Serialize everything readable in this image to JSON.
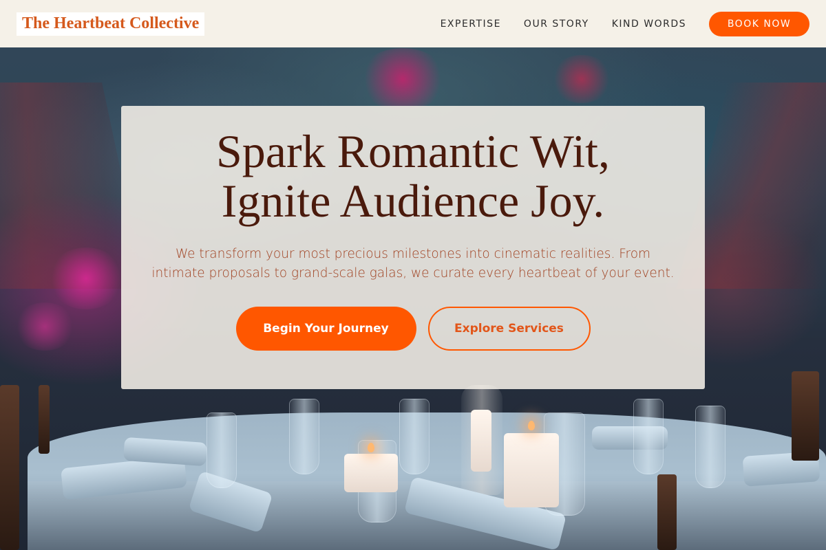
{
  "brand": {
    "name": "The Heartbeat Collective",
    "accent_color": "#ff5700",
    "logo_text_color": "#d5591c",
    "heading_color": "#4a1a0c"
  },
  "nav": {
    "links": [
      {
        "label": "EXPERTISE"
      },
      {
        "label": "OUR STORY"
      },
      {
        "label": "KIND WORDS"
      }
    ],
    "cta_label": "BOOK NOW"
  },
  "hero": {
    "title_line1": "Spark Romantic Wit,",
    "title_line2": "Ignite Audience Joy.",
    "subtitle": "We transform your most precious milestones into cinematic realities. From intimate proposals to grand-scale galas, we curate every heartbeat of your event.",
    "primary_cta": "Begin Your Journey",
    "secondary_cta": "Explore Services",
    "background_image": "banquet-table-photo"
  }
}
